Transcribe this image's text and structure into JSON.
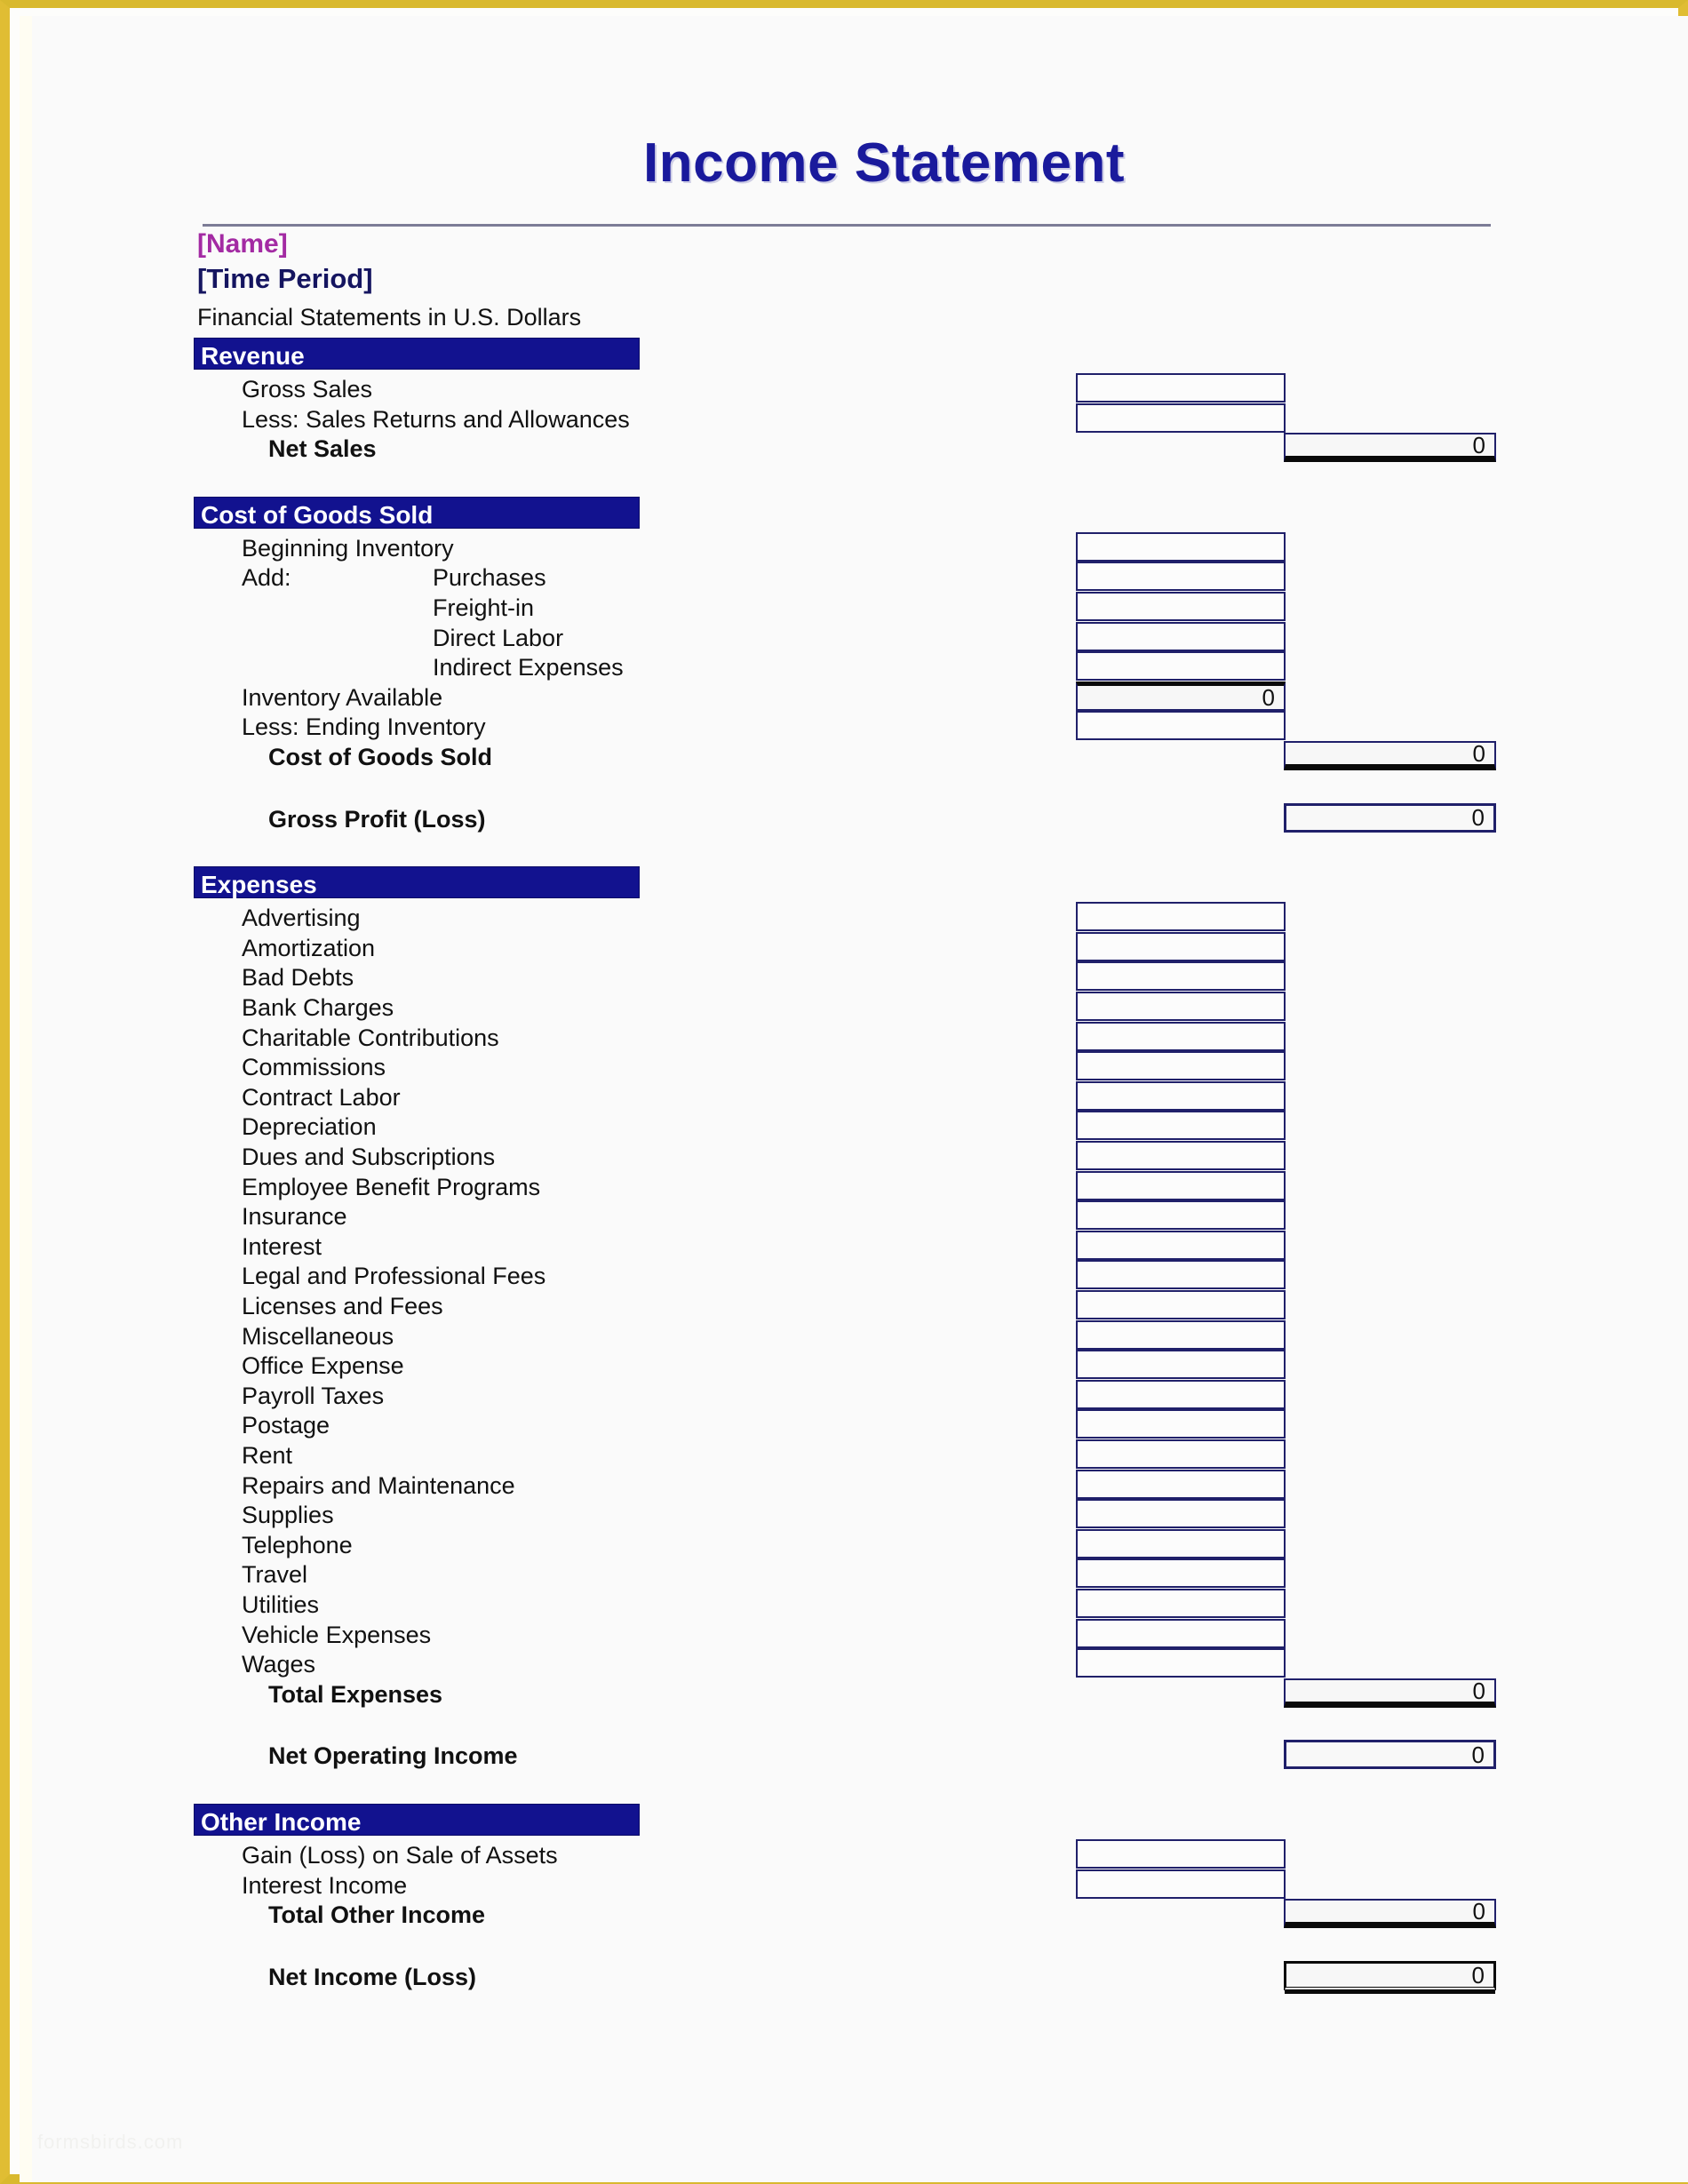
{
  "page": {
    "frame_color": "#e0bd33",
    "background": "#fafafa",
    "watermark": "formsbirds.com"
  },
  "header": {
    "title": "Income Statement",
    "title_color": "#1a1a9c",
    "name_placeholder": "[Name]",
    "name_color": "#a32aa3",
    "period_placeholder": "[Time Period]",
    "period_color": "#151560",
    "currency_note": "Financial Statements in U.S. Dollars"
  },
  "section_bar_color": "#12128f",
  "sections": [
    {
      "id": "revenue",
      "title": "Revenue",
      "rows": [
        {
          "label": "Gross Sales",
          "indent": 1,
          "bold": false,
          "cell": "input",
          "col": 1,
          "value": ""
        },
        {
          "label": "Less: Sales Returns and Allowances",
          "indent": 1,
          "bold": false,
          "cell": "input",
          "col": 1,
          "value": ""
        },
        {
          "label": "Net Sales",
          "indent": 2,
          "bold": true,
          "cell": "total",
          "col": 2,
          "value": "0"
        }
      ]
    },
    {
      "id": "cost-of-goods-sold",
      "title": "Cost of Goods Sold",
      "rows": [
        {
          "label": "Beginning Inventory",
          "indent": 1,
          "bold": false,
          "cell": "input",
          "col": 1,
          "value": ""
        },
        {
          "label": "Add:",
          "indent": 1,
          "bold": false,
          "cell": "input",
          "col": 1,
          "value": "",
          "sublabel": "Purchases"
        },
        {
          "label": "",
          "indent": 1,
          "bold": false,
          "cell": "input",
          "col": 1,
          "value": "",
          "sublabel": "Freight-in"
        },
        {
          "label": "",
          "indent": 1,
          "bold": false,
          "cell": "input",
          "col": 1,
          "value": "",
          "sublabel": "Direct Labor"
        },
        {
          "label": "",
          "indent": 1,
          "bold": false,
          "cell": "input",
          "col": 1,
          "value": "",
          "sublabel": "Indirect Expenses"
        },
        {
          "label": "Inventory Available",
          "indent": 1,
          "bold": false,
          "cell": "subtotal",
          "col": 1,
          "value": "0"
        },
        {
          "label": "Less: Ending Inventory",
          "indent": 1,
          "bold": false,
          "cell": "input",
          "col": 1,
          "value": ""
        },
        {
          "label": "Cost of Goods Sold",
          "indent": 2,
          "bold": true,
          "cell": "total",
          "col": 2,
          "value": "0"
        },
        {
          "label": "Gross Profit (Loss)",
          "indent": 2,
          "bold": true,
          "cell": "plain",
          "col": 2,
          "value": "0",
          "spacer": true
        }
      ]
    },
    {
      "id": "expenses",
      "title": "Expenses",
      "rows": [
        {
          "label": "Advertising",
          "indent": 1,
          "bold": false,
          "cell": "input",
          "col": 1,
          "value": ""
        },
        {
          "label": "Amortization",
          "indent": 1,
          "bold": false,
          "cell": "input",
          "col": 1,
          "value": ""
        },
        {
          "label": "Bad Debts",
          "indent": 1,
          "bold": false,
          "cell": "input",
          "col": 1,
          "value": ""
        },
        {
          "label": "Bank Charges",
          "indent": 1,
          "bold": false,
          "cell": "input",
          "col": 1,
          "value": ""
        },
        {
          "label": "Charitable Contributions",
          "indent": 1,
          "bold": false,
          "cell": "input",
          "col": 1,
          "value": ""
        },
        {
          "label": "Commissions",
          "indent": 1,
          "bold": false,
          "cell": "input",
          "col": 1,
          "value": ""
        },
        {
          "label": "Contract Labor",
          "indent": 1,
          "bold": false,
          "cell": "input",
          "col": 1,
          "value": ""
        },
        {
          "label": "Depreciation",
          "indent": 1,
          "bold": false,
          "cell": "input",
          "col": 1,
          "value": ""
        },
        {
          "label": "Dues and Subscriptions",
          "indent": 1,
          "bold": false,
          "cell": "input",
          "col": 1,
          "value": ""
        },
        {
          "label": "Employee Benefit Programs",
          "indent": 1,
          "bold": false,
          "cell": "input",
          "col": 1,
          "value": ""
        },
        {
          "label": "Insurance",
          "indent": 1,
          "bold": false,
          "cell": "input",
          "col": 1,
          "value": ""
        },
        {
          "label": "Interest",
          "indent": 1,
          "bold": false,
          "cell": "input",
          "col": 1,
          "value": ""
        },
        {
          "label": "Legal and Professional Fees",
          "indent": 1,
          "bold": false,
          "cell": "input",
          "col": 1,
          "value": ""
        },
        {
          "label": "Licenses and Fees",
          "indent": 1,
          "bold": false,
          "cell": "input",
          "col": 1,
          "value": ""
        },
        {
          "label": "Miscellaneous",
          "indent": 1,
          "bold": false,
          "cell": "input",
          "col": 1,
          "value": ""
        },
        {
          "label": "Office Expense",
          "indent": 1,
          "bold": false,
          "cell": "input",
          "col": 1,
          "value": ""
        },
        {
          "label": "Payroll Taxes",
          "indent": 1,
          "bold": false,
          "cell": "input",
          "col": 1,
          "value": ""
        },
        {
          "label": "Postage",
          "indent": 1,
          "bold": false,
          "cell": "input",
          "col": 1,
          "value": ""
        },
        {
          "label": "Rent",
          "indent": 1,
          "bold": false,
          "cell": "input",
          "col": 1,
          "value": ""
        },
        {
          "label": "Repairs and Maintenance",
          "indent": 1,
          "bold": false,
          "cell": "input",
          "col": 1,
          "value": ""
        },
        {
          "label": "Supplies",
          "indent": 1,
          "bold": false,
          "cell": "input",
          "col": 1,
          "value": ""
        },
        {
          "label": "Telephone",
          "indent": 1,
          "bold": false,
          "cell": "input",
          "col": 1,
          "value": ""
        },
        {
          "label": "Travel",
          "indent": 1,
          "bold": false,
          "cell": "input",
          "col": 1,
          "value": ""
        },
        {
          "label": "Utilities",
          "indent": 1,
          "bold": false,
          "cell": "input",
          "col": 1,
          "value": ""
        },
        {
          "label": "Vehicle Expenses",
          "indent": 1,
          "bold": false,
          "cell": "input",
          "col": 1,
          "value": ""
        },
        {
          "label": "Wages",
          "indent": 1,
          "bold": false,
          "cell": "input",
          "col": 1,
          "value": ""
        },
        {
          "label": "Total Expenses",
          "indent": 2,
          "bold": true,
          "cell": "total",
          "col": 2,
          "value": "0"
        },
        {
          "label": "Net Operating Income",
          "indent": 2,
          "bold": true,
          "cell": "plain",
          "col": 2,
          "value": "0",
          "spacer": true
        }
      ]
    },
    {
      "id": "other-income",
      "title": "Other Income",
      "rows": [
        {
          "label": "Gain (Loss) on Sale of Assets",
          "indent": 1,
          "bold": false,
          "cell": "input",
          "col": 1,
          "value": ""
        },
        {
          "label": "Interest Income",
          "indent": 1,
          "bold": false,
          "cell": "input",
          "col": 1,
          "value": ""
        },
        {
          "label": "Total Other Income",
          "indent": 2,
          "bold": true,
          "cell": "total",
          "col": 2,
          "value": "0"
        },
        {
          "label": "Net Income (Loss)",
          "indent": 2,
          "bold": true,
          "cell": "grand",
          "col": 2,
          "value": "0",
          "spacer": true
        }
      ]
    }
  ]
}
